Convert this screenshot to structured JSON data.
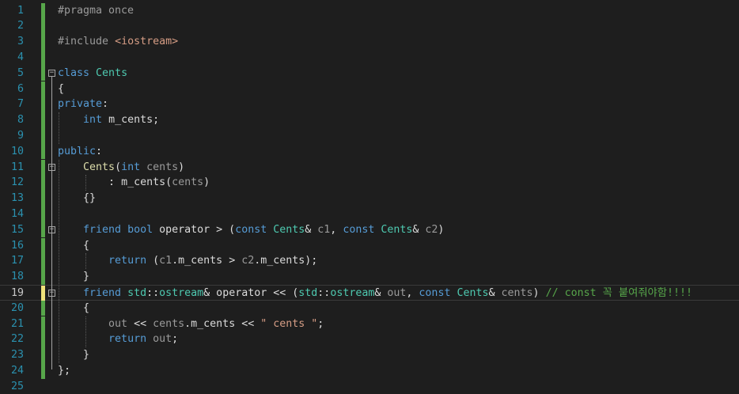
{
  "editor": {
    "language": "C++",
    "current_line": 19,
    "lines": [
      {
        "n": "1",
        "tokens": [
          {
            "t": "#pragma once",
            "c": "pp"
          }
        ]
      },
      {
        "n": "2",
        "tokens": []
      },
      {
        "n": "3",
        "tokens": [
          {
            "t": "#include ",
            "c": "pp"
          },
          {
            "t": "<iostream>",
            "c": "str"
          }
        ]
      },
      {
        "n": "4",
        "tokens": []
      },
      {
        "n": "5",
        "tokens": [
          {
            "t": "class ",
            "c": "kw"
          },
          {
            "t": "Cents",
            "c": "ty"
          }
        ]
      },
      {
        "n": "6",
        "tokens": [
          {
            "t": "{",
            "c": "plain"
          }
        ]
      },
      {
        "n": "7",
        "tokens": [
          {
            "t": "private",
            "c": "kw"
          },
          {
            "t": ":",
            "c": "plain"
          }
        ]
      },
      {
        "n": "8",
        "tokens": [
          {
            "t": "    ",
            "c": "plain"
          },
          {
            "t": "int ",
            "c": "kw"
          },
          {
            "t": "m_cents",
            "c": "fld"
          },
          {
            "t": ";",
            "c": "plain"
          }
        ]
      },
      {
        "n": "9",
        "tokens": []
      },
      {
        "n": "10",
        "tokens": [
          {
            "t": "public",
            "c": "kw"
          },
          {
            "t": ":",
            "c": "plain"
          }
        ]
      },
      {
        "n": "11",
        "tokens": [
          {
            "t": "    ",
            "c": "plain"
          },
          {
            "t": "Cents",
            "c": "fn"
          },
          {
            "t": "(",
            "c": "plain"
          },
          {
            "t": "int ",
            "c": "kw"
          },
          {
            "t": "cents",
            "c": "par"
          },
          {
            "t": ")",
            "c": "plain"
          }
        ]
      },
      {
        "n": "12",
        "tokens": [
          {
            "t": "        : ",
            "c": "plain"
          },
          {
            "t": "m_cents",
            "c": "fld"
          },
          {
            "t": "(",
            "c": "plain"
          },
          {
            "t": "cents",
            "c": "par"
          },
          {
            "t": ")",
            "c": "plain"
          }
        ]
      },
      {
        "n": "13",
        "tokens": [
          {
            "t": "    {}",
            "c": "plain"
          }
        ]
      },
      {
        "n": "14",
        "tokens": []
      },
      {
        "n": "15",
        "tokens": [
          {
            "t": "    ",
            "c": "plain"
          },
          {
            "t": "friend ",
            "c": "kw"
          },
          {
            "t": "bool ",
            "c": "kw"
          },
          {
            "t": "operator > (",
            "c": "plain"
          },
          {
            "t": "const ",
            "c": "kw"
          },
          {
            "t": "Cents",
            "c": "ty"
          },
          {
            "t": "& ",
            "c": "plain"
          },
          {
            "t": "c1",
            "c": "par"
          },
          {
            "t": ", ",
            "c": "plain"
          },
          {
            "t": "const ",
            "c": "kw"
          },
          {
            "t": "Cents",
            "c": "ty"
          },
          {
            "t": "& ",
            "c": "plain"
          },
          {
            "t": "c2",
            "c": "par"
          },
          {
            "t": ")",
            "c": "plain"
          }
        ]
      },
      {
        "n": "16",
        "tokens": [
          {
            "t": "    {",
            "c": "plain"
          }
        ]
      },
      {
        "n": "17",
        "tokens": [
          {
            "t": "        ",
            "c": "plain"
          },
          {
            "t": "return ",
            "c": "kw"
          },
          {
            "t": "(",
            "c": "plain"
          },
          {
            "t": "c1",
            "c": "par"
          },
          {
            "t": ".",
            "c": "plain"
          },
          {
            "t": "m_cents",
            "c": "fld"
          },
          {
            "t": " > ",
            "c": "plain"
          },
          {
            "t": "c2",
            "c": "par"
          },
          {
            "t": ".",
            "c": "plain"
          },
          {
            "t": "m_cents",
            "c": "fld"
          },
          {
            "t": ");",
            "c": "plain"
          }
        ]
      },
      {
        "n": "18",
        "tokens": [
          {
            "t": "    }",
            "c": "plain"
          }
        ]
      },
      {
        "n": "19",
        "tokens": [
          {
            "t": "    ",
            "c": "plain"
          },
          {
            "t": "friend ",
            "c": "kw"
          },
          {
            "t": "std",
            "c": "ty"
          },
          {
            "t": "::",
            "c": "plain"
          },
          {
            "t": "ostream",
            "c": "ty"
          },
          {
            "t": "& operator << (",
            "c": "plain"
          },
          {
            "t": "std",
            "c": "ty"
          },
          {
            "t": "::",
            "c": "plain"
          },
          {
            "t": "ostream",
            "c": "ty"
          },
          {
            "t": "& ",
            "c": "plain"
          },
          {
            "t": "out",
            "c": "par"
          },
          {
            "t": ", ",
            "c": "plain"
          },
          {
            "t": "const ",
            "c": "kw"
          },
          {
            "t": "Cents",
            "c": "ty"
          },
          {
            "t": "& ",
            "c": "plain"
          },
          {
            "t": "cents",
            "c": "par"
          },
          {
            "t": ") ",
            "c": "plain"
          },
          {
            "t": "// const 꼭 붙여줘야함!!!!",
            "c": "cmt"
          }
        ]
      },
      {
        "n": "20",
        "tokens": [
          {
            "t": "    {",
            "c": "plain"
          }
        ]
      },
      {
        "n": "21",
        "tokens": [
          {
            "t": "        ",
            "c": "plain"
          },
          {
            "t": "out",
            "c": "par"
          },
          {
            "t": " << ",
            "c": "plain"
          },
          {
            "t": "cents",
            "c": "par"
          },
          {
            "t": ".",
            "c": "plain"
          },
          {
            "t": "m_cents",
            "c": "fld"
          },
          {
            "t": " << ",
            "c": "plain"
          },
          {
            "t": "\" cents \"",
            "c": "str"
          },
          {
            "t": ";",
            "c": "plain"
          }
        ]
      },
      {
        "n": "22",
        "tokens": [
          {
            "t": "        ",
            "c": "plain"
          },
          {
            "t": "return ",
            "c": "kw"
          },
          {
            "t": "out",
            "c": "par"
          },
          {
            "t": ";",
            "c": "plain"
          }
        ]
      },
      {
        "n": "23",
        "tokens": [
          {
            "t": "    }",
            "c": "plain"
          }
        ]
      },
      {
        "n": "24",
        "tokens": [
          {
            "t": "};",
            "c": "plain"
          }
        ]
      },
      {
        "n": "25",
        "tokens": []
      }
    ]
  },
  "colors": {
    "background": "#1e1e1e",
    "line_number": "#2b91af",
    "keyword": "#569cd6",
    "type": "#4ec9b0",
    "function": "#dcdcaa",
    "comment": "#57a64a",
    "string": "#d69d85",
    "change_bar_saved": "#57a64a",
    "change_bar_unsaved": "#efe27a"
  },
  "icons": {
    "fold_toggle": "collapse-minus-box-icon"
  }
}
